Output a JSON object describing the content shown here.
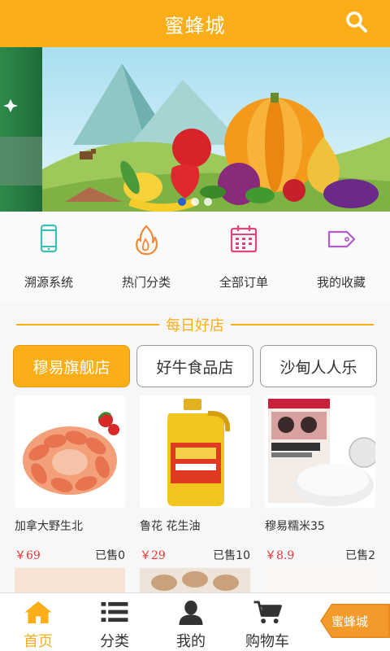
{
  "app": {
    "title": "蜜蜂城"
  },
  "quick_links": [
    {
      "label": "溯源系统",
      "icon": "phone-icon",
      "color": "#3ac0b0"
    },
    {
      "label": "热门分类",
      "icon": "flame-icon",
      "color": "#f08a3a"
    },
    {
      "label": "全部订单",
      "icon": "calendar-icon",
      "color": "#e0457b"
    },
    {
      "label": "我的收藏",
      "icon": "tag-icon",
      "color": "#b05cc8"
    }
  ],
  "section": {
    "title": "每日好店"
  },
  "shops": [
    {
      "label": "穆易旗舰店",
      "active": true
    },
    {
      "label": "好牛食品店",
      "active": false
    },
    {
      "label": "沙甸人人乐",
      "active": false
    }
  ],
  "products": [
    {
      "name": "加拿大野生北",
      "price": "￥69",
      "sold": "已售0"
    },
    {
      "name": "鲁花 花生油",
      "price": "￥29",
      "sold": "已售10"
    },
    {
      "name": "穆易糯米35",
      "price": "￥8.9",
      "sold": "已售2"
    }
  ],
  "tabbar": [
    {
      "label": "首页",
      "icon": "home-icon",
      "active": true
    },
    {
      "label": "分类",
      "icon": "list-icon",
      "active": false
    },
    {
      "label": "我的",
      "icon": "user-icon",
      "active": false
    },
    {
      "label": "购物车",
      "icon": "cart-icon",
      "active": false
    }
  ],
  "float_tag": {
    "label": "蜜蜂城"
  },
  "colors": {
    "accent": "#fbae17",
    "price": "#ee3333"
  }
}
